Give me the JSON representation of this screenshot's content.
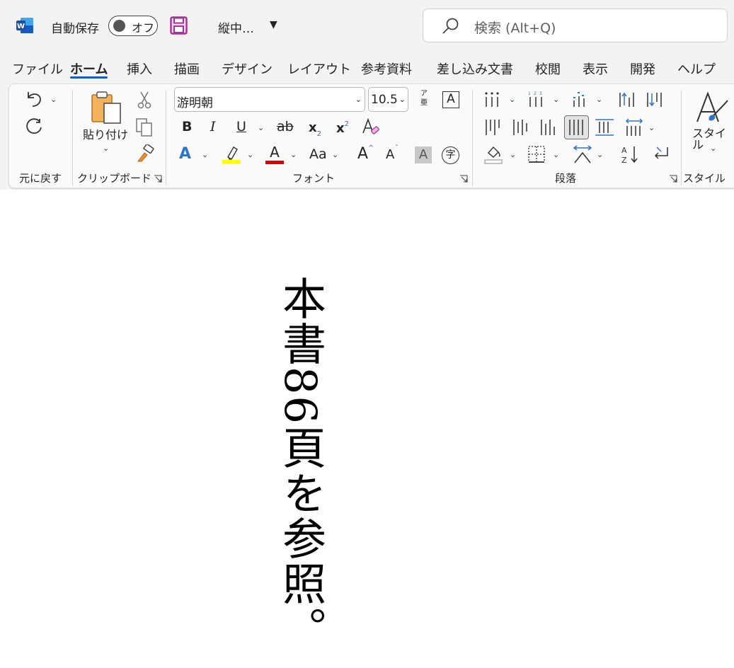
{
  "titlebar": {
    "app_icon": "word-logo-icon",
    "autosave_label": "自動保存",
    "autosave_state": "オフ",
    "save_icon": "save-icon",
    "doc_title": "縦中…",
    "search_placeholder": "検索 (Alt+Q)"
  },
  "tabs": [
    "ファイル",
    "ホーム",
    "挿入",
    "描画",
    "デザイン",
    "レイアウト",
    "参考資料",
    "差し込み文書",
    "校閲",
    "表示",
    "開発",
    "ヘルプ"
  ],
  "active_tab": "ホーム",
  "ribbon": {
    "undo_group_label": "元に戻す",
    "clipboard": {
      "label": "クリップボード",
      "paste_label": "貼り付け"
    },
    "font": {
      "label": "フォント",
      "font_name": "游明朝",
      "font_size": "10.5",
      "bold": "B",
      "italic": "I",
      "underline": "U",
      "strike": "ab",
      "subscript": "x",
      "subscript_mark": "2",
      "superscript": "x",
      "superscript_mark": "2",
      "grow": "A",
      "shrink": "A",
      "change_case": "Aa",
      "shade_char": "A",
      "enclose_char": "字",
      "char_border": "A",
      "phonetic_top": "ア",
      "phonetic_bottom": "亜",
      "highlight_color": "#ffff00",
      "font_color": "#e00000",
      "text_effect_color": "#2e75c7"
    },
    "paragraph": {
      "label": "段落"
    },
    "styles": {
      "label": "スタイル",
      "button_label": "スタイル"
    }
  },
  "document": {
    "text": "本書86頁を参照。"
  }
}
